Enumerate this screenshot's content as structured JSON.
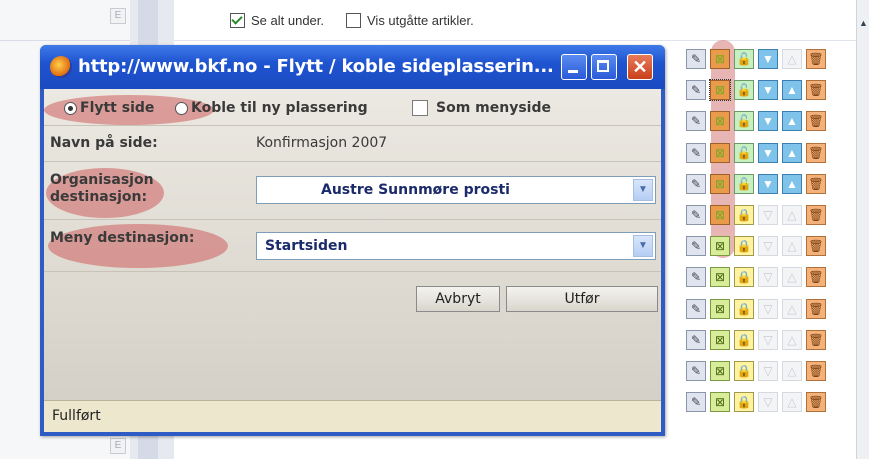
{
  "background_page": {
    "show_all_below_label": "Se alt under.",
    "show_expired_label": "Vis utgåtte artikler.",
    "show_all_below_checked": true,
    "show_expired_checked": false,
    "left_row_icon": "E",
    "action_rows": [
      [
        "edit",
        "move",
        "lock-green",
        "down",
        "disabled-up",
        "trash"
      ],
      [
        "edit",
        "move-active",
        "lock-green",
        "down",
        "up",
        "trash"
      ],
      [
        "edit",
        "move",
        "lock-green",
        "down",
        "up",
        "trash"
      ],
      [
        "edit",
        "move",
        "lock-green",
        "down",
        "up",
        "trash"
      ],
      [
        "edit",
        "move",
        "lock-green",
        "down",
        "up",
        "trash"
      ],
      [
        "edit",
        "move",
        "lock-yellow",
        "disabled-down",
        "disabled-up",
        "trash"
      ],
      [
        "edit",
        "move-on",
        "lock-yellow",
        "disabled-down",
        "disabled-up",
        "trash"
      ],
      [
        "edit",
        "move-on",
        "lock-yellow",
        "disabled-down",
        "disabled-up",
        "trash"
      ],
      [
        "edit",
        "move-on",
        "lock-yellow",
        "disabled-down",
        "disabled-up",
        "trash"
      ],
      [
        "edit",
        "move-on",
        "lock-yellow",
        "disabled-down",
        "disabled-up",
        "trash"
      ],
      [
        "edit",
        "move-on",
        "lock-yellow",
        "disabled-down",
        "disabled-up",
        "trash"
      ],
      [
        "edit",
        "move-on",
        "lock-yellow",
        "disabled-down",
        "disabled-up",
        "trash"
      ]
    ]
  },
  "dialog": {
    "title": "http://www.bkf.no - Flytt / koble sideplasserin...",
    "radio_move": "Flytt side",
    "radio_link": "Koble til ny plassering",
    "checkbox_menu_page": "Som menyside",
    "page_name_label": "Navn på side:",
    "page_name_value": "Konfirmasjon 2007",
    "org_dest_label": "Organisasjon destinasjon:",
    "org_dest_value": "Austre Sunnmøre prosti",
    "menu_dest_label": "Meny destinasjon:",
    "menu_dest_value": "Startsiden",
    "cancel_label": "Avbryt",
    "execute_label": "Utfør",
    "status_text": "Fullført"
  },
  "colors": {
    "titlebar": "#1f54d0",
    "annotation_highlight": "#cd5f5f"
  }
}
